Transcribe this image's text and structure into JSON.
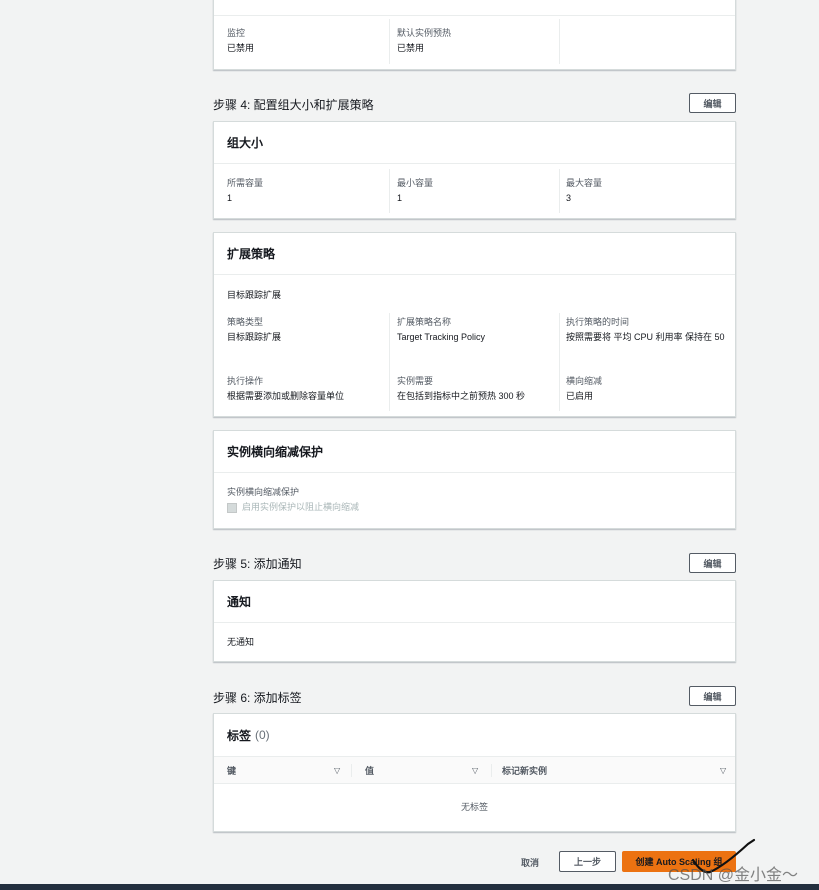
{
  "top_card": {
    "monitoring_label": "监控",
    "monitoring_value": "已禁用",
    "warmup_label": "默认实例预热",
    "warmup_value": "已禁用"
  },
  "step4": {
    "title": "步骤 4: 配置组大小和扩展策略",
    "edit": "编辑",
    "group_size": {
      "heading": "组大小",
      "desired_label": "所需容量",
      "desired_value": "1",
      "min_label": "最小容量",
      "min_value": "1",
      "max_label": "最大容量",
      "max_value": "3"
    },
    "scaling": {
      "heading": "扩展策略",
      "sub": "目标跟踪扩展",
      "type_label": "策略类型",
      "type_value": "目标跟踪扩展",
      "name_label": "扩展策略名称",
      "name_value": "Target Tracking Policy",
      "exec_label": "执行策略的时间",
      "exec_value": "按照需要将 平均 CPU 利用率 保持在 50",
      "action_label": "执行操作",
      "action_value": "根据需要添加或删除容量单位",
      "instance_label": "实例需要",
      "instance_value": "在包括到指标中之前预热 300 秒",
      "scalein_label": "横向缩减",
      "scalein_value": "已启用"
    },
    "protection": {
      "heading": "实例横向缩减保护",
      "label": "实例横向缩减保护",
      "checkbox": "启用实例保护以阻止横向缩减"
    }
  },
  "step5": {
    "title": "步骤 5: 添加通知",
    "edit": "编辑",
    "heading": "通知",
    "value": "无通知"
  },
  "step6": {
    "title": "步骤 6: 添加标签",
    "edit": "编辑",
    "heading": "标签",
    "count": "(0)",
    "columns": [
      "键",
      "值",
      "标记新实例"
    ],
    "empty": "无标签"
  },
  "footer": {
    "cancel": "取消",
    "previous": "上一步",
    "create": "创建 Auto Scaling 组"
  },
  "watermark": "CSDN @金小金～",
  "colors": {
    "primary": "#ec7211",
    "border": "#d5dbdb",
    "background": "#f2f3f3"
  }
}
